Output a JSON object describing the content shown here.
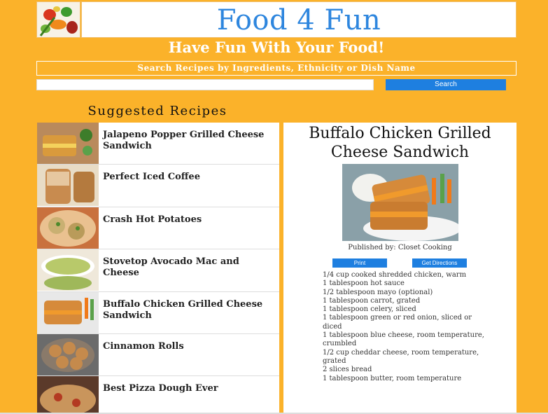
{
  "header": {
    "title": "Food 4 Fun",
    "tagline": "Have Fun With Your Food!",
    "search_banner": "Search Recipes by Ingredients, Ethnicity or Dish Name",
    "search_placeholder": "",
    "search_button": "Search"
  },
  "suggested": {
    "heading": "Suggested Recipes",
    "items": [
      {
        "label": "Jalapeno Popper Grilled Cheese Sandwich"
      },
      {
        "label": "Perfect Iced Coffee"
      },
      {
        "label": "Crash Hot Potatoes"
      },
      {
        "label": "Stovetop Avocado Mac and Cheese"
      },
      {
        "label": "Buffalo Chicken Grilled Cheese Sandwich"
      },
      {
        "label": "Cinnamon Rolls"
      },
      {
        "label": "Best Pizza Dough Ever"
      }
    ]
  },
  "detail": {
    "title": "Buffalo Chicken Grilled Cheese Sandwich",
    "publisher": "Published by: Closet Cooking",
    "print_button": "Print",
    "directions_button": "Get Directions",
    "ingredients": [
      "1/4 cup cooked shredded chicken, warm",
      "1 tablespoon hot sauce",
      "1/2 tablespoon mayo (optional)",
      "1 tablespoon carrot, grated",
      "1 tablespoon celery, sliced",
      "1 tablespoon green or red onion, sliced or diced",
      "1 tablespoon blue cheese, room temperature, crumbled",
      "1/2 cup cheddar cheese, room temperature, grated",
      "2 slices bread",
      "1 tablespoon butter, room temperature"
    ]
  },
  "colors": {
    "background": "#fbb22a",
    "brand_blue": "#2e86de",
    "button_blue": "#1e7fe0"
  }
}
